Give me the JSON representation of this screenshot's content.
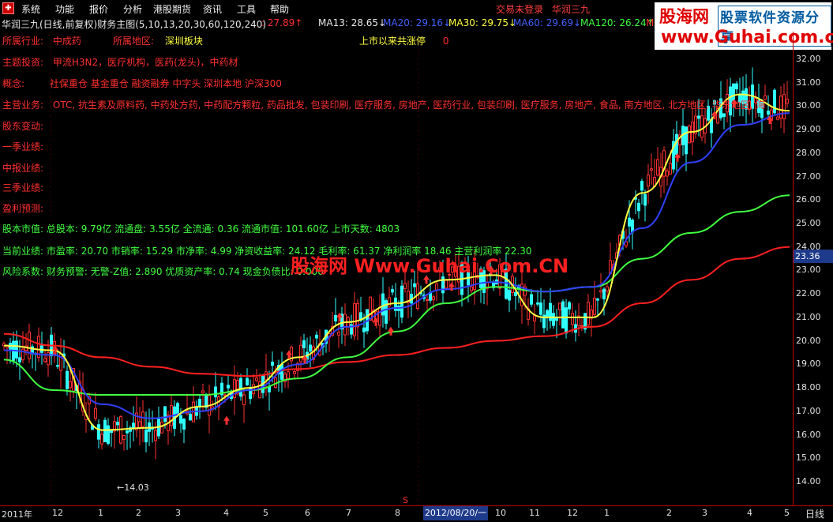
{
  "menu": {
    "items": [
      "系统",
      "功能",
      "报价",
      "分析",
      "港股期货",
      "资讯",
      "工具",
      "帮助"
    ],
    "status": "交易未登录",
    "stock_name": "华润三九"
  },
  "watermark": {
    "title": "股海网",
    "subtitle": "股票软件资源分享",
    "url": "www.Guhai.com.cn",
    "overlay": "股海网 Www.Guhai.Com.CN"
  },
  "header": {
    "title": "华润三九(日线,前复权)",
    "main_chart": "财务主图(5,10,13,20,30,60,120,240)",
    "price": ": 27.89↑"
  },
  "indicators": [
    {
      "label": "MA13: 28.65↓",
      "color": "#e8e8e8"
    },
    {
      "label": "MA20: 29.16↓",
      "color": "#4060ff"
    },
    {
      "label": "MA30: 29.75↓",
      "color": "#ffff40"
    },
    {
      "label": "MA60: 29.69↓",
      "color": "#4060ff"
    },
    {
      "label": "MA120: 26.24↑",
      "color": "#40ff40"
    },
    {
      "label": "M",
      "color": "#ff3030"
    }
  ],
  "fundamentals": {
    "industry_label": "所属行业:",
    "industry": "中成药",
    "region_label": "所属地区:",
    "region": "深圳板块",
    "limit_label": "上市以来共涨停",
    "limit": "0",
    "theme_label": "主题投资:",
    "theme": "甲流H3N2，医疗机构，医药(龙头)，中药材",
    "concept_label": "概念:",
    "concept": "社保重仓 基金重仓 融资融券 中字头 深圳本地 沪深300",
    "business_label": "主营业务:",
    "business": "OTC, 抗生素及原料药, 中药处方药, 中药配方颗粒, 药品批发, 包装印刷, 医疗服务, 房地产, 医药行业, 包装印刷, 医疗服务, 房地产, 食品, 南方地区, 北方地区, 华东地区, 海",
    "holder_label": "股东变动:",
    "q1_label": "一季业绩:",
    "mid_label": "中报业绩:",
    "q3_label": "三季业绩:",
    "forecast_label": "盈利预测:",
    "equity": "股本市值: 总股本: 9.79亿 流通盘: 3.55亿 全流通: 0.36 流通市值: 101.60亿 上市天数: 4803",
    "perf": "当前业绩: 市盈率: 20.70 市销率: 15.29 市净率: 4.99 净资收益率: 24.12 毛利率: 61.37 净利润率 18.46 主营利润率 22.30",
    "risk": "风险系数: 财务预警: 无警-Z值: 2.890 优质资产率: 0.74 现金负债比: 0.000"
  },
  "chart_data": {
    "type": "line",
    "title": "华润三九(日线,前复权)",
    "ylim": [
      14.0,
      32.5
    ],
    "y_ticks": [
      "32.00",
      "31.00",
      "30.00",
      "29.00",
      "28.00",
      "27.00",
      "26.00",
      "25.00",
      "24.00",
      "23.00",
      "22.00",
      "21.00",
      "20.00",
      "19.00",
      "18.00",
      "17.00",
      "16.00",
      "15.00",
      "14.00"
    ],
    "x_ticks": [
      "2011年",
      "12",
      "1",
      "2",
      "3",
      "4",
      "5",
      "6",
      "7",
      "8",
      "10",
      "11",
      "12",
      "1",
      "2",
      "3",
      "4",
      "5"
    ],
    "current_price": "23.36",
    "selected_date": "2012/08/20/一",
    "period": "日线",
    "low_label": "←14.03",
    "marker": "S",
    "series": [
      {
        "name": "MA120",
        "color": "#ff2020",
        "values": [
          20.3,
          19.8,
          19.3,
          18.9,
          18.6,
          18.5,
          18.8,
          19.1,
          19.4,
          19.7,
          20.0,
          20.2,
          20.6,
          21.6,
          22.6,
          23.5,
          24.0
        ]
      },
      {
        "name": "MA60",
        "color": "#40ff40",
        "values": [
          19.2,
          17.9,
          17.7,
          17.7,
          17.7,
          17.9,
          18.4,
          19.3,
          20.4,
          21.6,
          22.3,
          22.1,
          22.3,
          23.5,
          24.6,
          25.5,
          26.2
        ]
      },
      {
        "name": "MA20",
        "color": "#3040ff",
        "values": [
          19.6,
          19.4,
          17.3,
          16.7,
          17.0,
          17.9,
          19.0,
          20.6,
          21.4,
          22.2,
          22.5,
          22.1,
          22.3,
          24.8,
          27.6,
          29.2,
          29.7
        ]
      },
      {
        "name": "MA30",
        "color": "#ffff40",
        "values": [
          19.8,
          19.6,
          16.2,
          16.3,
          17.2,
          18.0,
          19.3,
          20.8,
          21.6,
          22.6,
          22.8,
          21.0,
          21.0,
          26.3,
          28.9,
          30.5,
          29.8
        ]
      }
    ]
  }
}
